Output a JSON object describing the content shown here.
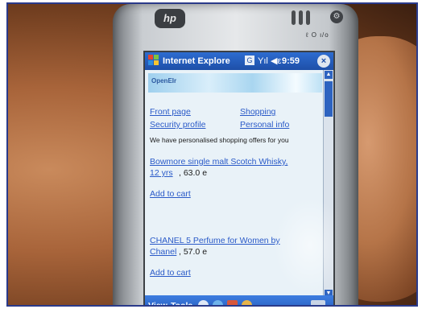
{
  "device": {
    "brand_badge": "hp",
    "hardware_label": "ℓ O ι/ο"
  },
  "titlebar": {
    "app_title": "Internet Explore",
    "time": "9:59",
    "close_glyph": "×"
  },
  "banner": {
    "logo_text": "OpenEIr"
  },
  "nav_links": {
    "front_page": "Front page",
    "shopping": "Shopping",
    "security_profile": "Security profile",
    "personal_info": "Personal info"
  },
  "offers": {
    "intro": "We have personalised shopping offers for you",
    "item1_link_line1": "Bowmore single malt Scotch Whisky,",
    "item1_link_line2": "12 yrs",
    "item1_price": ", 63.0 e",
    "item1_cart": "Add to cart",
    "item2_link_line1": "CHANEL 5 Perfume for Women by",
    "item2_link_line2": "Chanel",
    "item2_price": ", 57.0 e",
    "item2_cart": "Add to cart"
  },
  "bottombar": {
    "view_menu": "View",
    "tools_menu": "Tools"
  },
  "icons": {
    "windows_flag": "windows-flag-icon",
    "signal": "signal-antenna-icon",
    "volume": "speaker-volume-icon",
    "close": "close-icon",
    "back": "back-arrow-icon",
    "ie": "internet-explorer-icon",
    "home": "home-icon",
    "favorites": "favorites-icon",
    "keyboard": "keyboard-icon"
  },
  "colors": {
    "titlebar_blue": "#1e4fa8",
    "link_blue": "#2a5ac8",
    "screen_bg": "#e9f2f8"
  }
}
